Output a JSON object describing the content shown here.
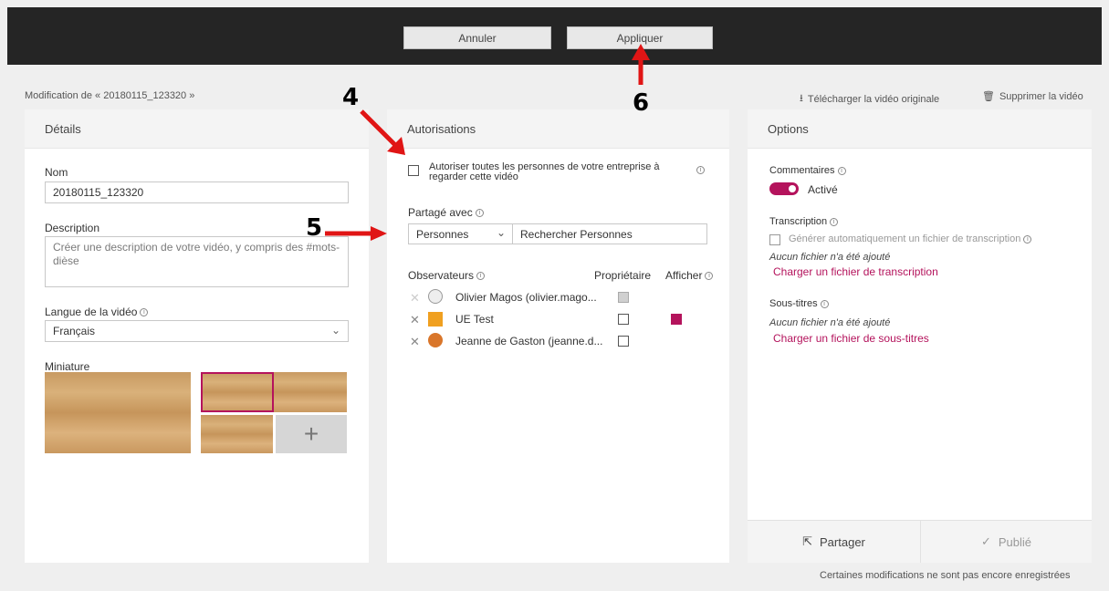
{
  "toolbar": {
    "cancel_label": "Annuler",
    "apply_label": "Appliquer"
  },
  "breadcrumb": "Modification de « 20180115_123320 »",
  "header_links": {
    "download": "Télécharger la vidéo originale",
    "delete": "Supprimer la vidéo"
  },
  "details": {
    "title": "Détails",
    "name_label": "Nom",
    "name_value": "20180115_123320",
    "description_label": "Description",
    "description_placeholder": "Créer une description de votre vidéo, y compris des #mots-dièse",
    "language_label": "Langue de la vidéo",
    "language_value": "Français",
    "thumbnail_label": "Miniature"
  },
  "permissions": {
    "title": "Autorisations",
    "allow_all_label": "Autoriser toutes les personnes de votre entreprise à regarder cette vidéo",
    "shared_with_label": "Partagé avec",
    "shared_type": "Personnes",
    "search_placeholder": "Rechercher Personnes",
    "viewers_header": "Observateurs",
    "owner_header": "Propriétaire",
    "display_header": "Afficher",
    "viewers": [
      {
        "name": "Olivier Magos (olivier.mago...",
        "owner": true,
        "display": false
      },
      {
        "name": "UE Test",
        "owner": false,
        "display": true
      },
      {
        "name": "Jeanne de Gaston (jeanne.d...",
        "owner": false,
        "display": false
      }
    ]
  },
  "options": {
    "title": "Options",
    "comments_label": "Commentaires",
    "comments_state": "Activé",
    "transcription_label": "Transcription",
    "transcription_auto_label": "Générer automatiquement un fichier de transcription",
    "transcription_none": "Aucun fichier n'a été ajouté",
    "transcription_upload": "Charger un fichier de transcription",
    "subtitles_label": "Sous-titres",
    "subtitles_none": "Aucun fichier n'a été ajouté",
    "subtitles_upload": "Charger un fichier de sous-titres",
    "share_label": "Partager",
    "published_label": "Publié"
  },
  "status_message": "Certaines modifications ne sont pas encore enregistrées",
  "annotations": {
    "a4": "4",
    "a5": "5",
    "a6": "6"
  },
  "colors": {
    "accent": "#b4135c",
    "topbar": "#252525",
    "annotation": "#e01515"
  }
}
